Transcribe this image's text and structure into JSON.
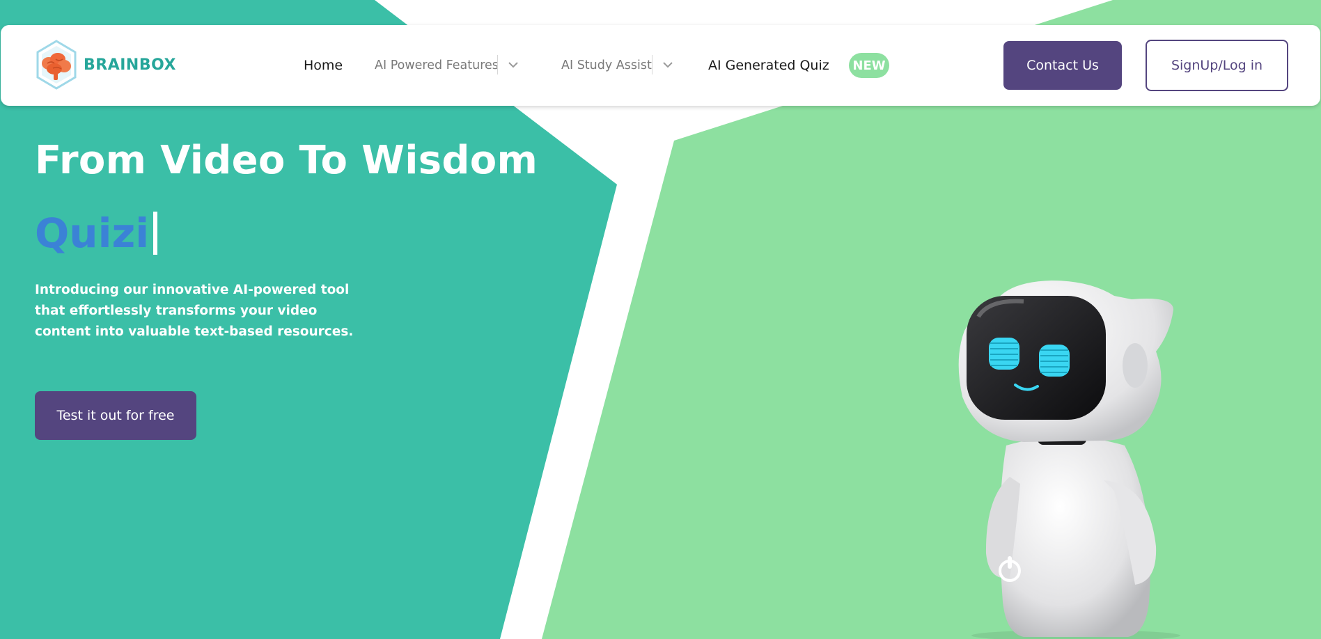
{
  "colors": {
    "teal": "#3bbfa7",
    "green": "#8de0a0",
    "purple": "#54457f",
    "blue": "#3b82d6",
    "logo_teal": "#26a69a"
  },
  "logo": {
    "text": "BRAINBOX",
    "icon": "brain-hexagon-icon"
  },
  "nav": {
    "home": "Home",
    "ai_powered_features": "AI Powered Features",
    "ai_study_assist": "AI Study Assist",
    "ai_generated_quiz": "AI Generated Quiz",
    "new_badge": "NEW",
    "dropdown_icon": "chevron-down-icon"
  },
  "actions": {
    "contact": "Contact Us",
    "signup": "SignUp/Log in"
  },
  "hero": {
    "title": "From Video To Wisdom",
    "typed": "Quizi",
    "description": "Introducing our innovative AI-powered tool that effortlessly transforms your video content into valuable text-based resources.",
    "cta": "Test it out for free",
    "illustration": "robot-illustration"
  }
}
